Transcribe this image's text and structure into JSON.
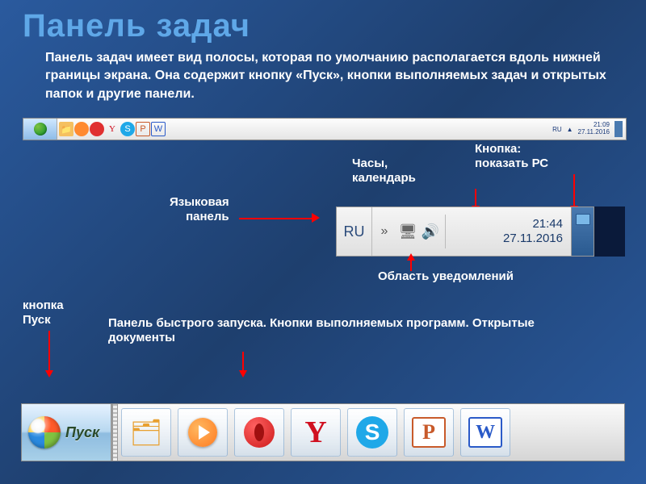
{
  "title": "Панель задач",
  "description": "Панель задач имеет вид полосы, которая по умолчанию располагается вдоль нижней границы экрана. Она содержит кнопку «Пуск», кнопки выполняемых задач и открытых папок и другие панели.",
  "labels": {
    "clock_calendar": "Часы,\nкалендарь",
    "show_desktop": "Кнопка:\nпоказать РС",
    "language_panel": "Языковая\nпанель",
    "notification_area": "Область уведомлений",
    "start_button": "кнопка\nПуск",
    "quick_launch": "Панель быстрого запуска. Кнопки выполняемых программ. Открытые документы"
  },
  "tray": {
    "language": "RU",
    "time": "21:44",
    "date": "27.11.2016"
  },
  "taskbar_mini_tray": {
    "language": "RU",
    "time": "21:09",
    "date": "27.11.2016"
  },
  "start_button_text": "Пуск",
  "icons": {
    "folder": "folder-icon",
    "media": "media-player-icon",
    "opera": "opera-icon",
    "yandex": "yandex-icon",
    "skype": "skype-icon",
    "powerpoint": "powerpoint-icon",
    "word": "word-icon",
    "network": "network-icon",
    "volume": "volume-icon",
    "chevrons": "expand-icon"
  }
}
